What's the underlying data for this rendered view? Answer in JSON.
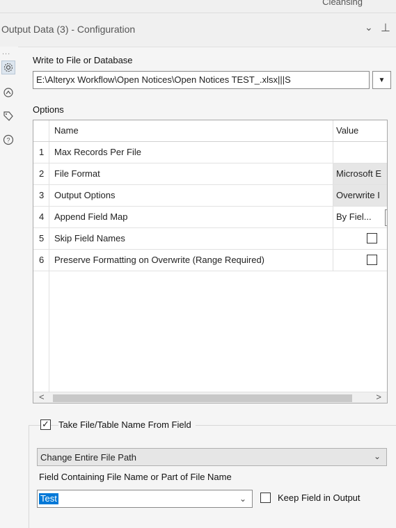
{
  "top_strip": {
    "label": "Cleansing"
  },
  "header": {
    "title": "Output Data (3) - Configuration",
    "collapse_icon": "chevron-down-icon",
    "pin_icon": "pin-icon"
  },
  "sidebar": {
    "overflow": "...",
    "icons": [
      "gear-icon",
      "connection-icon",
      "tag-icon",
      "help-icon"
    ]
  },
  "write_to": {
    "label": "Write to File or Database",
    "value": "E:\\Alteryx Workflow\\Open Notices\\Open Notices TEST_.xlsx|||S"
  },
  "options": {
    "label": "Options",
    "col_name": "Name",
    "col_value": "Value",
    "rows": [
      {
        "num": "1",
        "name": "Max Records Per File",
        "value": ""
      },
      {
        "num": "2",
        "name": "File Format",
        "value": "Microsoft E"
      },
      {
        "num": "3",
        "name": "Output Options",
        "value": "Overwrite I"
      },
      {
        "num": "4",
        "name": "Append Field Map",
        "value": "By Fiel..."
      },
      {
        "num": "5",
        "name": "Skip Field Names",
        "value": ""
      },
      {
        "num": "6",
        "name": "Preserve Formatting on Overwrite (Range Required)",
        "value": ""
      }
    ],
    "scroll_left": "<",
    "scroll_right": ">"
  },
  "take_name": {
    "checked_mark": "✓",
    "label": "Take File/Table Name From Field",
    "mode_value": "Change Entire File Path",
    "field_label": "Field Containing File Name or Part of File Name",
    "field_value": "Test",
    "keep_label": "Keep Field in Output"
  },
  "colors": {
    "accent": "#0078d7",
    "panel": "#f5f5f5",
    "grey_cell": "#e6e6e6"
  }
}
